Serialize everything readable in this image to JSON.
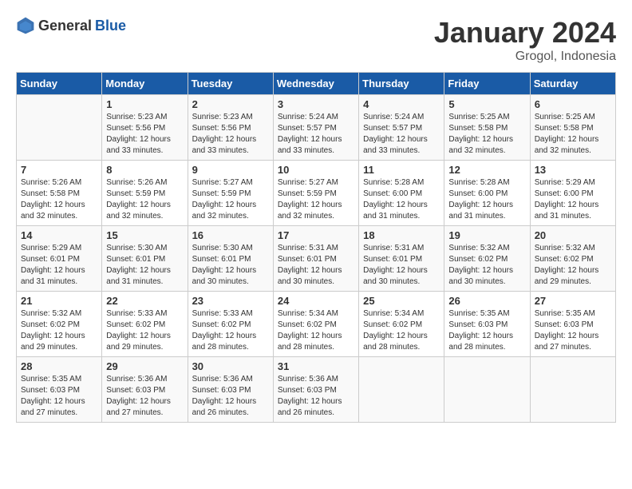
{
  "logo": {
    "general": "General",
    "blue": "Blue"
  },
  "header": {
    "month": "January 2024",
    "location": "Grogol, Indonesia"
  },
  "weekdays": [
    "Sunday",
    "Monday",
    "Tuesday",
    "Wednesday",
    "Thursday",
    "Friday",
    "Saturday"
  ],
  "weeks": [
    [
      {
        "day": "",
        "sunrise": "",
        "sunset": "",
        "daylight": ""
      },
      {
        "day": "1",
        "sunrise": "5:23 AM",
        "sunset": "5:56 PM",
        "daylight": "12 hours and 33 minutes."
      },
      {
        "day": "2",
        "sunrise": "5:23 AM",
        "sunset": "5:56 PM",
        "daylight": "12 hours and 33 minutes."
      },
      {
        "day": "3",
        "sunrise": "5:24 AM",
        "sunset": "5:57 PM",
        "daylight": "12 hours and 33 minutes."
      },
      {
        "day": "4",
        "sunrise": "5:24 AM",
        "sunset": "5:57 PM",
        "daylight": "12 hours and 33 minutes."
      },
      {
        "day": "5",
        "sunrise": "5:25 AM",
        "sunset": "5:58 PM",
        "daylight": "12 hours and 32 minutes."
      },
      {
        "day": "6",
        "sunrise": "5:25 AM",
        "sunset": "5:58 PM",
        "daylight": "12 hours and 32 minutes."
      }
    ],
    [
      {
        "day": "7",
        "sunrise": "5:26 AM",
        "sunset": "5:58 PM",
        "daylight": "12 hours and 32 minutes."
      },
      {
        "day": "8",
        "sunrise": "5:26 AM",
        "sunset": "5:59 PM",
        "daylight": "12 hours and 32 minutes."
      },
      {
        "day": "9",
        "sunrise": "5:27 AM",
        "sunset": "5:59 PM",
        "daylight": "12 hours and 32 minutes."
      },
      {
        "day": "10",
        "sunrise": "5:27 AM",
        "sunset": "5:59 PM",
        "daylight": "12 hours and 32 minutes."
      },
      {
        "day": "11",
        "sunrise": "5:28 AM",
        "sunset": "6:00 PM",
        "daylight": "12 hours and 31 minutes."
      },
      {
        "day": "12",
        "sunrise": "5:28 AM",
        "sunset": "6:00 PM",
        "daylight": "12 hours and 31 minutes."
      },
      {
        "day": "13",
        "sunrise": "5:29 AM",
        "sunset": "6:00 PM",
        "daylight": "12 hours and 31 minutes."
      }
    ],
    [
      {
        "day": "14",
        "sunrise": "5:29 AM",
        "sunset": "6:01 PM",
        "daylight": "12 hours and 31 minutes."
      },
      {
        "day": "15",
        "sunrise": "5:30 AM",
        "sunset": "6:01 PM",
        "daylight": "12 hours and 31 minutes."
      },
      {
        "day": "16",
        "sunrise": "5:30 AM",
        "sunset": "6:01 PM",
        "daylight": "12 hours and 30 minutes."
      },
      {
        "day": "17",
        "sunrise": "5:31 AM",
        "sunset": "6:01 PM",
        "daylight": "12 hours and 30 minutes."
      },
      {
        "day": "18",
        "sunrise": "5:31 AM",
        "sunset": "6:01 PM",
        "daylight": "12 hours and 30 minutes."
      },
      {
        "day": "19",
        "sunrise": "5:32 AM",
        "sunset": "6:02 PM",
        "daylight": "12 hours and 30 minutes."
      },
      {
        "day": "20",
        "sunrise": "5:32 AM",
        "sunset": "6:02 PM",
        "daylight": "12 hours and 29 minutes."
      }
    ],
    [
      {
        "day": "21",
        "sunrise": "5:32 AM",
        "sunset": "6:02 PM",
        "daylight": "12 hours and 29 minutes."
      },
      {
        "day": "22",
        "sunrise": "5:33 AM",
        "sunset": "6:02 PM",
        "daylight": "12 hours and 29 minutes."
      },
      {
        "day": "23",
        "sunrise": "5:33 AM",
        "sunset": "6:02 PM",
        "daylight": "12 hours and 28 minutes."
      },
      {
        "day": "24",
        "sunrise": "5:34 AM",
        "sunset": "6:02 PM",
        "daylight": "12 hours and 28 minutes."
      },
      {
        "day": "25",
        "sunrise": "5:34 AM",
        "sunset": "6:02 PM",
        "daylight": "12 hours and 28 minutes."
      },
      {
        "day": "26",
        "sunrise": "5:35 AM",
        "sunset": "6:03 PM",
        "daylight": "12 hours and 28 minutes."
      },
      {
        "day": "27",
        "sunrise": "5:35 AM",
        "sunset": "6:03 PM",
        "daylight": "12 hours and 27 minutes."
      }
    ],
    [
      {
        "day": "28",
        "sunrise": "5:35 AM",
        "sunset": "6:03 PM",
        "daylight": "12 hours and 27 minutes."
      },
      {
        "day": "29",
        "sunrise": "5:36 AM",
        "sunset": "6:03 PM",
        "daylight": "12 hours and 27 minutes."
      },
      {
        "day": "30",
        "sunrise": "5:36 AM",
        "sunset": "6:03 PM",
        "daylight": "12 hours and 26 minutes."
      },
      {
        "day": "31",
        "sunrise": "5:36 AM",
        "sunset": "6:03 PM",
        "daylight": "12 hours and 26 minutes."
      },
      {
        "day": "",
        "sunrise": "",
        "sunset": "",
        "daylight": ""
      },
      {
        "day": "",
        "sunrise": "",
        "sunset": "",
        "daylight": ""
      },
      {
        "day": "",
        "sunrise": "",
        "sunset": "",
        "daylight": ""
      }
    ]
  ]
}
